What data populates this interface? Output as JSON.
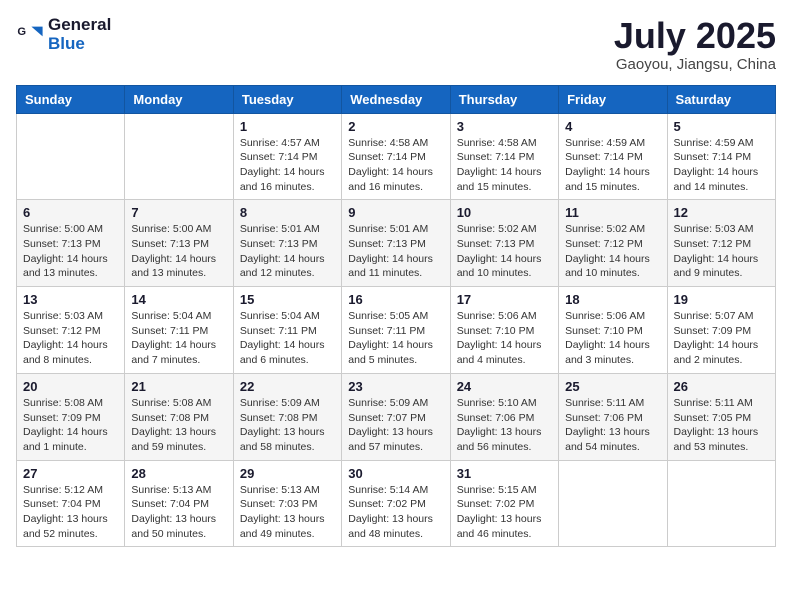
{
  "header": {
    "logo_general": "General",
    "logo_blue": "Blue",
    "title": "July 2025",
    "subtitle": "Gaoyou, Jiangsu, China"
  },
  "days_of_week": [
    "Sunday",
    "Monday",
    "Tuesday",
    "Wednesday",
    "Thursday",
    "Friday",
    "Saturday"
  ],
  "weeks": [
    [
      {
        "day": "",
        "info": ""
      },
      {
        "day": "",
        "info": ""
      },
      {
        "day": "1",
        "info": "Sunrise: 4:57 AM\nSunset: 7:14 PM\nDaylight: 14 hours\nand 16 minutes."
      },
      {
        "day": "2",
        "info": "Sunrise: 4:58 AM\nSunset: 7:14 PM\nDaylight: 14 hours\nand 16 minutes."
      },
      {
        "day": "3",
        "info": "Sunrise: 4:58 AM\nSunset: 7:14 PM\nDaylight: 14 hours\nand 15 minutes."
      },
      {
        "day": "4",
        "info": "Sunrise: 4:59 AM\nSunset: 7:14 PM\nDaylight: 14 hours\nand 15 minutes."
      },
      {
        "day": "5",
        "info": "Sunrise: 4:59 AM\nSunset: 7:14 PM\nDaylight: 14 hours\nand 14 minutes."
      }
    ],
    [
      {
        "day": "6",
        "info": "Sunrise: 5:00 AM\nSunset: 7:13 PM\nDaylight: 14 hours\nand 13 minutes."
      },
      {
        "day": "7",
        "info": "Sunrise: 5:00 AM\nSunset: 7:13 PM\nDaylight: 14 hours\nand 13 minutes."
      },
      {
        "day": "8",
        "info": "Sunrise: 5:01 AM\nSunset: 7:13 PM\nDaylight: 14 hours\nand 12 minutes."
      },
      {
        "day": "9",
        "info": "Sunrise: 5:01 AM\nSunset: 7:13 PM\nDaylight: 14 hours\nand 11 minutes."
      },
      {
        "day": "10",
        "info": "Sunrise: 5:02 AM\nSunset: 7:13 PM\nDaylight: 14 hours\nand 10 minutes."
      },
      {
        "day": "11",
        "info": "Sunrise: 5:02 AM\nSunset: 7:12 PM\nDaylight: 14 hours\nand 10 minutes."
      },
      {
        "day": "12",
        "info": "Sunrise: 5:03 AM\nSunset: 7:12 PM\nDaylight: 14 hours\nand 9 minutes."
      }
    ],
    [
      {
        "day": "13",
        "info": "Sunrise: 5:03 AM\nSunset: 7:12 PM\nDaylight: 14 hours\nand 8 minutes."
      },
      {
        "day": "14",
        "info": "Sunrise: 5:04 AM\nSunset: 7:11 PM\nDaylight: 14 hours\nand 7 minutes."
      },
      {
        "day": "15",
        "info": "Sunrise: 5:04 AM\nSunset: 7:11 PM\nDaylight: 14 hours\nand 6 minutes."
      },
      {
        "day": "16",
        "info": "Sunrise: 5:05 AM\nSunset: 7:11 PM\nDaylight: 14 hours\nand 5 minutes."
      },
      {
        "day": "17",
        "info": "Sunrise: 5:06 AM\nSunset: 7:10 PM\nDaylight: 14 hours\nand 4 minutes."
      },
      {
        "day": "18",
        "info": "Sunrise: 5:06 AM\nSunset: 7:10 PM\nDaylight: 14 hours\nand 3 minutes."
      },
      {
        "day": "19",
        "info": "Sunrise: 5:07 AM\nSunset: 7:09 PM\nDaylight: 14 hours\nand 2 minutes."
      }
    ],
    [
      {
        "day": "20",
        "info": "Sunrise: 5:08 AM\nSunset: 7:09 PM\nDaylight: 14 hours\nand 1 minute."
      },
      {
        "day": "21",
        "info": "Sunrise: 5:08 AM\nSunset: 7:08 PM\nDaylight: 13 hours\nand 59 minutes."
      },
      {
        "day": "22",
        "info": "Sunrise: 5:09 AM\nSunset: 7:08 PM\nDaylight: 13 hours\nand 58 minutes."
      },
      {
        "day": "23",
        "info": "Sunrise: 5:09 AM\nSunset: 7:07 PM\nDaylight: 13 hours\nand 57 minutes."
      },
      {
        "day": "24",
        "info": "Sunrise: 5:10 AM\nSunset: 7:06 PM\nDaylight: 13 hours\nand 56 minutes."
      },
      {
        "day": "25",
        "info": "Sunrise: 5:11 AM\nSunset: 7:06 PM\nDaylight: 13 hours\nand 54 minutes."
      },
      {
        "day": "26",
        "info": "Sunrise: 5:11 AM\nSunset: 7:05 PM\nDaylight: 13 hours\nand 53 minutes."
      }
    ],
    [
      {
        "day": "27",
        "info": "Sunrise: 5:12 AM\nSunset: 7:04 PM\nDaylight: 13 hours\nand 52 minutes."
      },
      {
        "day": "28",
        "info": "Sunrise: 5:13 AM\nSunset: 7:04 PM\nDaylight: 13 hours\nand 50 minutes."
      },
      {
        "day": "29",
        "info": "Sunrise: 5:13 AM\nSunset: 7:03 PM\nDaylight: 13 hours\nand 49 minutes."
      },
      {
        "day": "30",
        "info": "Sunrise: 5:14 AM\nSunset: 7:02 PM\nDaylight: 13 hours\nand 48 minutes."
      },
      {
        "day": "31",
        "info": "Sunrise: 5:15 AM\nSunset: 7:02 PM\nDaylight: 13 hours\nand 46 minutes."
      },
      {
        "day": "",
        "info": ""
      },
      {
        "day": "",
        "info": ""
      }
    ]
  ]
}
